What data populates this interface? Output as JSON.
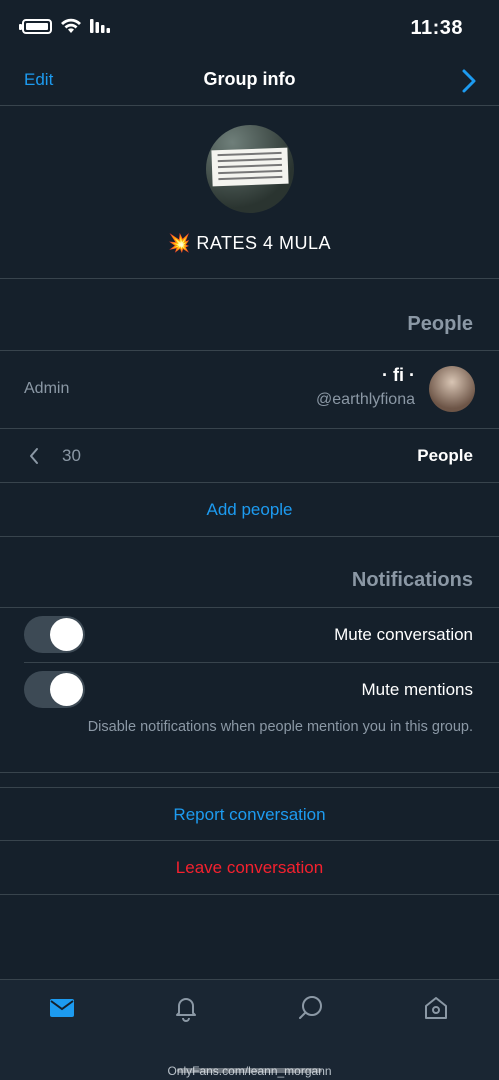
{
  "status": {
    "time": "11:38"
  },
  "header": {
    "edit_label": "Edit",
    "title": "Group info"
  },
  "group": {
    "name": "💥 RATES 4 MULA"
  },
  "people_section": {
    "heading": "People",
    "member": {
      "name": "· fi ·",
      "handle": "@earthlyfiona",
      "role": "Admin"
    },
    "people_row": {
      "label": "People",
      "count": "30"
    },
    "add_people": "Add people"
  },
  "notifications_section": {
    "heading": "Notifications",
    "mute_conversation": {
      "label": "Mute conversation",
      "on": false
    },
    "mute_mentions": {
      "label": "Mute mentions",
      "on": false,
      "helper": "Disable notifications when people mention you in this group."
    }
  },
  "actions": {
    "report": "Report conversation",
    "leave": "Leave conversation"
  },
  "colors": {
    "bg": "#15202b",
    "accent": "#1d9bf0",
    "danger": "#f4212e",
    "divider": "#38444d",
    "muted": "#8b98a5"
  },
  "tabbar": {
    "tabs": [
      {
        "icon": "messages-icon",
        "active": true
      },
      {
        "icon": "notifications-icon",
        "active": false
      },
      {
        "icon": "search-icon",
        "active": false
      },
      {
        "icon": "home-icon",
        "active": false
      }
    ]
  },
  "watermark": "OnlyFans.com/leann_morgann"
}
